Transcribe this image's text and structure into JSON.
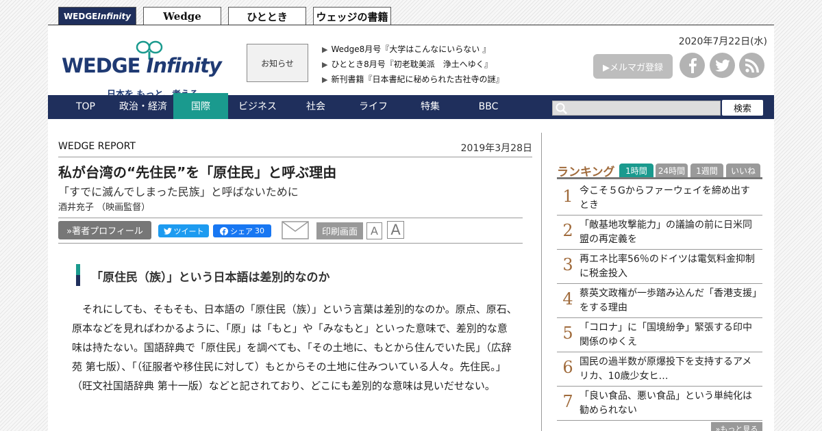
{
  "site_tabs": [
    {
      "label_a": "WEDGE ",
      "label_b": "Infinity"
    },
    {
      "label": "Wedge"
    },
    {
      "label": "ひととき"
    },
    {
      "label": "ウェッジの書籍"
    }
  ],
  "logo": {
    "main_a": "WEDGE",
    "main_b": "Infinity",
    "tagline": "日本を もっと、考える"
  },
  "header": {
    "notice_label": "お知らせ",
    "headlines": [
      "Wedge8月号『大学はこんなにいらない 』",
      "ひととき8月号『初老耽美派　浄土へゆく』",
      "新刊書籍『日本書紀に秘められた古社寺の謎』"
    ],
    "date": "2020年7月22日(水)",
    "mailmag_label": "▶メルマガ登録"
  },
  "nav": {
    "items": [
      "TOP",
      "政治・経済",
      "国際",
      "ビジネス",
      "社会",
      "ライフ",
      "特集",
      "BBC"
    ],
    "active_index": 2,
    "search_placeholder": "",
    "search_button": "検索"
  },
  "article": {
    "section": "WEDGE REPORT",
    "date": "2019年3月28日",
    "title": "私が台湾の“先住民”を「原住民」と呼ぶ理由",
    "subtitle": "「すでに滅んでしまった民族」と呼ばないために",
    "author": "酒井充子 （映画監督）",
    "profile_button": "»著者プロフィール",
    "tweet_label": "ツイート",
    "share_label": "シェア",
    "share_count": "30",
    "print_label": "印刷画面",
    "font_small": "A",
    "font_large": "A",
    "heading": "「原住民（族）」という日本語は差別的なのか",
    "body": "それにしても、そもそも、日本語の「原住民（族）」という言葉は差別的なのか。原点、原石、原本などを見ればわかるように、「原」は「もと」や「みなもと」といった意味で、差別的な意味は持たない。国語辞典で「原住民」を調べても、「その土地に、もとから住んでいた民」（広辞苑 第七版）、「（征服者や移住民に対して）もとからその土地に住みついている人々。先住民。」（旺文社国語辞典 第十一版）などと記されており、どこにも差別的な意味は見いだせない。"
  },
  "ranking": {
    "title": "ランキング",
    "tabs": [
      "1時間",
      "24時間",
      "1週間",
      "いいね"
    ],
    "active_tab": 0,
    "items": [
      {
        "rank": "1",
        "text": "今こそ５Gからファーウェイを締め出すとき"
      },
      {
        "rank": "2",
        "text": "「敵基地攻撃能力」の議論の前に日米同盟の再定義を"
      },
      {
        "rank": "3",
        "text": "再エネ比率56％のドイツは電気料金抑制に税金投入"
      },
      {
        "rank": "4",
        "text": "蔡英文政権が一歩踏み込んだ「香港支援」をする理由"
      },
      {
        "rank": "5",
        "text": "「コロナ」に「国境紛争」緊張する印中関係のゆくえ"
      },
      {
        "rank": "6",
        "text": "国民の過半数が原爆投下を支持するアメリカ、10歳少女ヒ…"
      },
      {
        "rank": "7",
        "text": "「良い食品、悪い食品」という単純化は勧められない"
      }
    ],
    "more_label": "»もっと見る"
  },
  "colors": {
    "navy": "#1f2f5c",
    "teal": "#1a9a8e",
    "rank_brown": "#a06b3c"
  },
  "icons": [
    "twitter-bird-icon",
    "facebook-icon",
    "mail-icon",
    "search-icon",
    "rss-icon",
    "triangle-bullet-icon"
  ]
}
